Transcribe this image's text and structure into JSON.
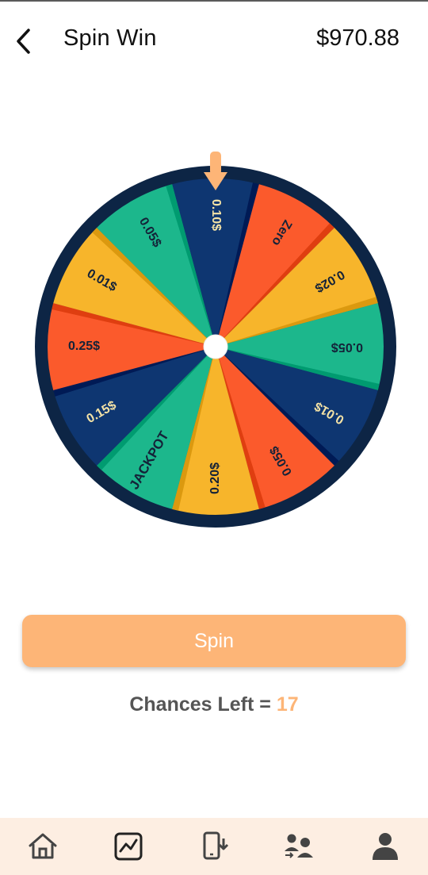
{
  "header": {
    "title": "Spin Win",
    "balance": "$970.88"
  },
  "wheel": {
    "pointer_color": "#fdb577",
    "rim_color": "#0d2545",
    "segments": [
      {
        "label": "0.10$",
        "color": "#0e3671"
      },
      {
        "label": "Zero",
        "color": "#fb5a2c"
      },
      {
        "label": "0.02$",
        "color": "#f7b52b"
      },
      {
        "label": "0.05$",
        "color": "#1cb78c"
      },
      {
        "label": "0.01$",
        "color": "#0e3671"
      },
      {
        "label": "0.05$",
        "color": "#fb5a2c"
      },
      {
        "label": "0.20$",
        "color": "#f7b52b"
      },
      {
        "label": "JACKPOT",
        "color": "#1cb78c"
      },
      {
        "label": "0.15$",
        "color": "#0e3671"
      },
      {
        "label": "0.25$",
        "color": "#fb5a2c"
      },
      {
        "label": "0.01$",
        "color": "#f7b52b"
      },
      {
        "label": "0.05$",
        "color": "#1cb78c"
      }
    ]
  },
  "spin_button": {
    "label": "Spin"
  },
  "chances": {
    "label": "Chances Left = ",
    "count": "17"
  },
  "bottom_nav": {
    "items": [
      {
        "icon": "home-icon"
      },
      {
        "icon": "chart-icon"
      },
      {
        "icon": "phone-download-icon"
      },
      {
        "icon": "users-transfer-icon"
      },
      {
        "icon": "profile-icon"
      }
    ]
  },
  "colors": {
    "accent": "#fdb577",
    "nav_background": "#fdeee2"
  }
}
